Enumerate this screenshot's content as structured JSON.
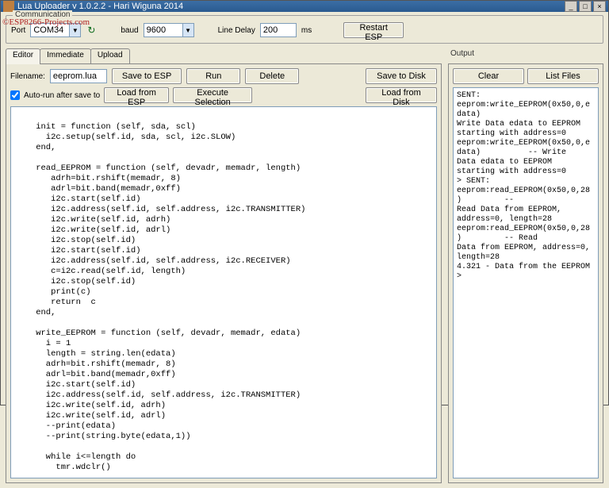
{
  "title": "Lua Uploader v 1.0.2.2 - Hari Wiguna 2014",
  "watermark": "©ESP8266-Projects.com",
  "winbtns": {
    "min": "_",
    "max": "□",
    "close": "×"
  },
  "comm": {
    "legend": "Communication",
    "port_label": "Port",
    "port_value": "COM34",
    "refresh_glyph": "↻",
    "baud_label": "baud",
    "baud_value": "9600",
    "delay_label": "Line Delay",
    "delay_value": "200",
    "ms_label": "ms",
    "restart": "Restart ESP",
    "dropdown_glyph": "▼"
  },
  "tabs": {
    "editor": "Editor",
    "immediate": "Immediate",
    "upload": "Upload"
  },
  "editor": {
    "filename_label": "Filename:",
    "filename_value": "eeprom.lua",
    "save_esp": "Save to ESP",
    "run": "Run",
    "delete": "Delete",
    "save_disk": "Save to Disk",
    "autorun_label": "Auto-run after save to",
    "load_esp": "Load from ESP",
    "exec_sel": "Execute Selection",
    "load_disk": "Load from Disk",
    "code": "\n    init = function (self, sda, scl)\n      i2c.setup(self.id, sda, scl, i2c.SLOW)\n    end,\n\n    read_EEPROM = function (self, devadr, memadr, length)\n       adrh=bit.rshift(memadr, 8)\n       adrl=bit.band(memadr,0xff)\n       i2c.start(self.id)\n       i2c.address(self.id, self.address, i2c.TRANSMITTER)\n       i2c.write(self.id, adrh)\n       i2c.write(self.id, adrl)\n       i2c.stop(self.id)\n       i2c.start(self.id)\n       i2c.address(self.id, self.address, i2c.RECEIVER)\n       c=i2c.read(self.id, length)\n       i2c.stop(self.id)\n       print(c)\n       return  c\n    end,\n\n    write_EEPROM = function (self, devadr, memadr, edata)\n      i = 1\n      length = string.len(edata)\n      adrh=bit.rshift(memadr, 8)\n      adrl=bit.band(memadr,0xff)\n      i2c.start(self.id)\n      i2c.address(self.id, self.address, i2c.TRANSMITTER)\n      i2c.write(self.id, adrh)\n      i2c.write(self.id, adrl)\n      --print(edata)\n      --print(string.byte(edata,1))\n\n      while i<=length do\n        tmr.wdclr()"
  },
  "output": {
    "legend": "Output",
    "clear": "Clear",
    "list_files": "List Files",
    "text": "SENT: eeprom:write_EEPROM(0x50,0,edata)\nWrite Data edata to EEPROM starting with address=0\neeprom:write_EEPROM(0x50,0,edata)          -- Write\nData edata to EEPROM starting with address=0\n> SENT: eeprom:read_EEPROM(0x50,0,28)         --\nRead Data from EEPROM, address=0, length=28\neeprom:read_EEPROM(0x50,0,28)         -- Read\nData from EEPROM, address=0, length=28\n4.321 - Data from the EEPROM\n>"
  }
}
